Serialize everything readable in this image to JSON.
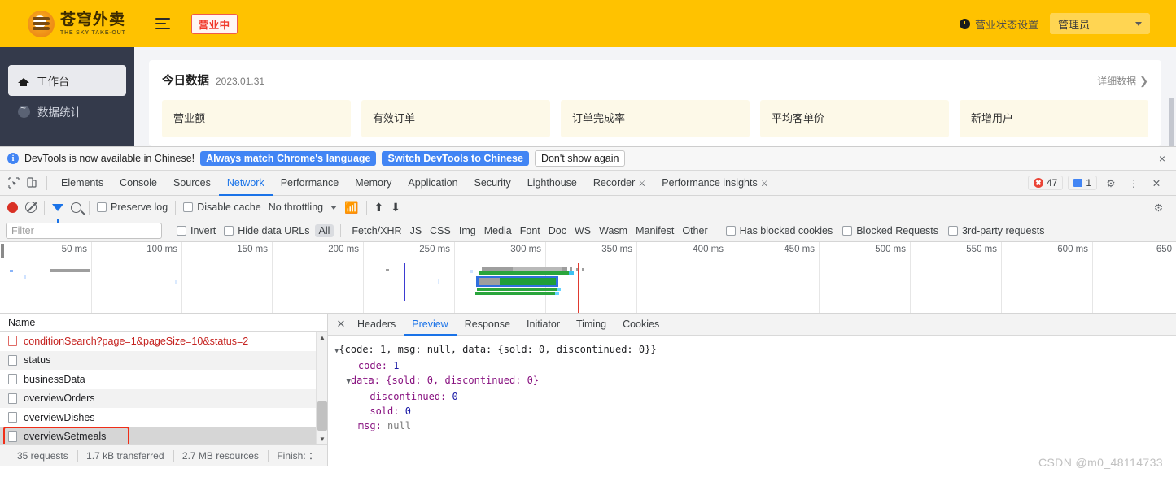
{
  "app": {
    "logo": {
      "cn": "苍穹外卖",
      "en": "THE SKY TAKE-OUT"
    },
    "status_pill": "营业中",
    "business_setting": "营业状态设置",
    "user_role": "管理员",
    "sidebar": [
      {
        "label": "工作台",
        "icon": "home-icon",
        "active": true
      },
      {
        "label": "数据统计",
        "icon": "chart-icon",
        "active": false
      }
    ],
    "card": {
      "title": "今日数据",
      "date": "2023.01.31",
      "detail_link": "详细数据",
      "stats": [
        {
          "label": "营业额"
        },
        {
          "label": "有效订单"
        },
        {
          "label": "订单完成率"
        },
        {
          "label": "平均客单价"
        },
        {
          "label": "新增用户"
        }
      ]
    }
  },
  "devtools": {
    "infobar": {
      "message": "DevTools is now available in Chinese!",
      "btn_always": "Always match Chrome's language",
      "btn_switch": "Switch DevTools to Chinese",
      "btn_dismiss": "Don't show again",
      "close": "×"
    },
    "tabs": [
      {
        "label": "Elements",
        "active": false
      },
      {
        "label": "Console",
        "active": false
      },
      {
        "label": "Sources",
        "active": false
      },
      {
        "label": "Network",
        "active": true
      },
      {
        "label": "Performance",
        "active": false
      },
      {
        "label": "Memory",
        "active": false
      },
      {
        "label": "Application",
        "active": false
      },
      {
        "label": "Security",
        "active": false
      },
      {
        "label": "Lighthouse",
        "active": false
      },
      {
        "label": "Recorder",
        "active": false,
        "experimental": true
      },
      {
        "label": "Performance insights",
        "active": false,
        "experimental": true
      }
    ],
    "badges": {
      "errors": "47",
      "messages": "1"
    },
    "toolbar": {
      "preserve_log": "Preserve log",
      "disable_cache": "Disable cache",
      "throttling": "No throttling"
    },
    "filterbar": {
      "filter_placeholder": "Filter",
      "invert": "Invert",
      "hide_data_urls": "Hide data URLs",
      "types": [
        "All",
        "Fetch/XHR",
        "JS",
        "CSS",
        "Img",
        "Media",
        "Font",
        "Doc",
        "WS",
        "Wasm",
        "Manifest",
        "Other"
      ],
      "selected_type": "All",
      "has_blocked_cookies": "Has blocked cookies",
      "blocked_requests": "Blocked Requests",
      "third_party_requests": "3rd-party requests"
    },
    "overview": {
      "ticks": [
        "50 ms",
        "100 ms",
        "150 ms",
        "200 ms",
        "250 ms",
        "300 ms",
        "350 ms",
        "400 ms",
        "450 ms",
        "500 ms",
        "550 ms",
        "600 ms",
        "650"
      ]
    },
    "requests": {
      "column_name": "Name",
      "rows": [
        {
          "name": "conditionSearch?page=1&pageSize=10&status=2",
          "error": true,
          "selected": false
        },
        {
          "name": "status",
          "error": false,
          "selected": false
        },
        {
          "name": "businessData",
          "error": false,
          "selected": false
        },
        {
          "name": "overviewOrders",
          "error": false,
          "selected": false
        },
        {
          "name": "overviewDishes",
          "error": false,
          "selected": false
        },
        {
          "name": "overviewSetmeals",
          "error": false,
          "selected": true,
          "highlighted": true
        }
      ]
    },
    "status": {
      "requests": "35 requests",
      "transferred": "1.7 kB transferred",
      "resources": "2.7 MB resources",
      "finish": "Finish: ："
    },
    "preview_tabs": [
      {
        "label": "Headers",
        "active": false
      },
      {
        "label": "Preview",
        "active": true
      },
      {
        "label": "Response",
        "active": false
      },
      {
        "label": "Initiator",
        "active": false
      },
      {
        "label": "Timing",
        "active": false
      },
      {
        "label": "Cookies",
        "active": false
      }
    ],
    "preview_json": {
      "line1": "{code: 1, msg: null, data: {sold: 0, discontinued: 0}}",
      "line2_key": "code:",
      "line2_val": "1",
      "line3": "data: {sold: 0, discontinued: 0}",
      "line4_key": "discontinued:",
      "line4_val": "0",
      "line5_key": "sold:",
      "line5_val": "0",
      "line6_key": "msg:",
      "line6_val": "null"
    }
  },
  "watermark": "CSDN @m0_48114733",
  "colors": {
    "brand_yellow": "#FFC200",
    "sidebar_dark": "#343A4B",
    "devtools_blue": "#1a73e8",
    "error_red": "#c5221f",
    "highlight_red": "#f02e18"
  }
}
